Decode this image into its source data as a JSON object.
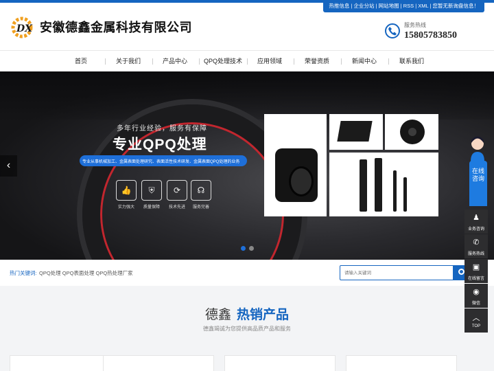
{
  "top_links": "热推信息 | 企业分站 | 网站地图 | RSS | XML | 您暂无新询盘信息！",
  "header": {
    "logo_text": "DX",
    "company_name": "安徽德鑫金属科技有限公司",
    "hotline_label": "服务热线",
    "hotline_number": "15805783850"
  },
  "nav": [
    "首页",
    "关于我们",
    "产品中心",
    "QPQ处理技术",
    "应用领域",
    "荣誉资质",
    "新闻中心",
    "联系我们"
  ],
  "banner": {
    "slogan": "多年行业经验，服务有保障",
    "title": "专业QPQ处理",
    "desc": "专业从事机械加工、金属表面处理研究、表面活性技术研发、金属表面QPQ处理的业务",
    "features": [
      {
        "icon": "thumbs-up-icon",
        "glyph": "👍",
        "label": "实力强大"
      },
      {
        "icon": "shield-icon",
        "glyph": "⛨",
        "label": "质量保障"
      },
      {
        "icon": "share-nodes-icon",
        "glyph": "⟳",
        "label": "技术先进"
      },
      {
        "icon": "headset-icon",
        "glyph": "☊",
        "label": "服务完善"
      }
    ],
    "arrow_left": "‹",
    "active_color": "#1e6fd9"
  },
  "search": {
    "hot_label": "热门关键词:",
    "hot_words": "QPQ处理  QPQ表面处理  QPQ热处理厂家",
    "placeholder": "请输入关键词"
  },
  "products": {
    "title_part1": "德鑫",
    "title_part2": "热销产品",
    "subtitle": "德鑫竭诚为您提供高品质产品和服务"
  },
  "sidebar": {
    "online_service": "在线咨询",
    "buttons": [
      {
        "icon": "qq-icon",
        "glyph": "♟",
        "label": "业务咨询"
      },
      {
        "icon": "phone-icon",
        "glyph": "✆",
        "label": "服务热线"
      },
      {
        "icon": "message-icon",
        "glyph": "▣",
        "label": "在线留言"
      },
      {
        "icon": "wechat-icon",
        "glyph": "◉",
        "label": "微信"
      },
      {
        "icon": "top-arrow-icon",
        "glyph": "︿",
        "label": "TOP"
      }
    ]
  }
}
